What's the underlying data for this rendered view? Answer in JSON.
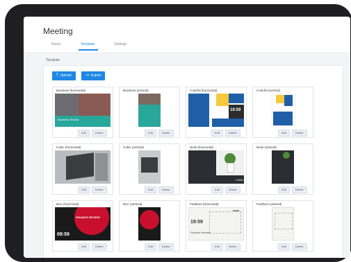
{
  "app": {
    "title": "Meeting",
    "tabs": [
      {
        "label": "Room"
      },
      {
        "label": "Template"
      },
      {
        "label": "Settings"
      }
    ]
  },
  "section": {
    "label": "Template"
  },
  "toolbar": {
    "upload": "Upload",
    "export": "Export"
  },
  "card_actions": {
    "edit": "Edit",
    "delete": "Delete"
  },
  "cards": [
    {
      "title": "Business (horizontal)"
    },
    {
      "title": "Business (vertical)"
    },
    {
      "title": "Colorful (horizontal)"
    },
    {
      "title": "Colorful (vertical)"
    },
    {
      "title": "Cubic (horizontal)"
    },
    {
      "title": "Cubic (vertical)"
    },
    {
      "title": "Desk (horizontal)"
    },
    {
      "title": "Desk (vertical)"
    },
    {
      "title": "Disc (horizontal)"
    },
    {
      "title": "Disc (vertical)"
    },
    {
      "title": "Feathers (horizontal)"
    },
    {
      "title": "Feathers (vertical)"
    }
  ],
  "thumbnail_text": {
    "business_h_title": "Business Review",
    "colorful_h_time": "19:59",
    "desk_h_brand": "CVAN",
    "disc_h_heading": "FINANCE REVIEW",
    "disc_h_time": "09:59",
    "feathers_h_time": "19:59",
    "feathers_h_brand": "cvan",
    "feathers_h_title": "Finance Review"
  },
  "colors": {
    "accent": "#1e88e5",
    "business": "#2aa79b",
    "colorful_blue": "#1f5fa8",
    "colorful_yellow": "#f6c93c",
    "desk": "#2a2d31",
    "disc": "#c8102e"
  }
}
